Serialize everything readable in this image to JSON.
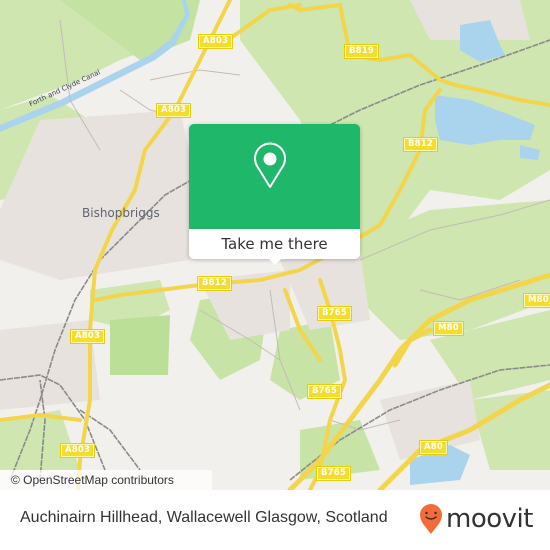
{
  "map": {
    "place_labels": [
      {
        "id": "bishopbriggs",
        "text": "Bishopbriggs"
      }
    ],
    "canal_label": "Forth and Clyde Canal",
    "road_labels": [
      {
        "id": "a803-1",
        "text": "A803"
      },
      {
        "id": "a803-2",
        "text": "A803"
      },
      {
        "id": "b819",
        "text": "B819"
      },
      {
        "id": "b812-1",
        "text": "B812"
      },
      {
        "id": "b812-2",
        "text": "B812"
      },
      {
        "id": "b765-1",
        "text": "B765"
      },
      {
        "id": "b765-2",
        "text": "B765"
      },
      {
        "id": "b765-3",
        "text": "B765"
      },
      {
        "id": "m80-1",
        "text": "M80"
      },
      {
        "id": "m80-2",
        "text": "M80"
      },
      {
        "id": "a803-3",
        "text": "A803"
      },
      {
        "id": "a803-4",
        "text": "A803"
      },
      {
        "id": "a80",
        "text": "A80"
      }
    ],
    "attribution": "© OpenStreetMap contributors"
  },
  "popup": {
    "icon": "location-pin-icon",
    "button_label": "Take me there",
    "color": "#1fb76a"
  },
  "footer": {
    "title": "Auchinairn Hillhead, Wallacewell Glasgow, Scotland",
    "brand": "moovit",
    "brand_color": "#f26b3a"
  }
}
